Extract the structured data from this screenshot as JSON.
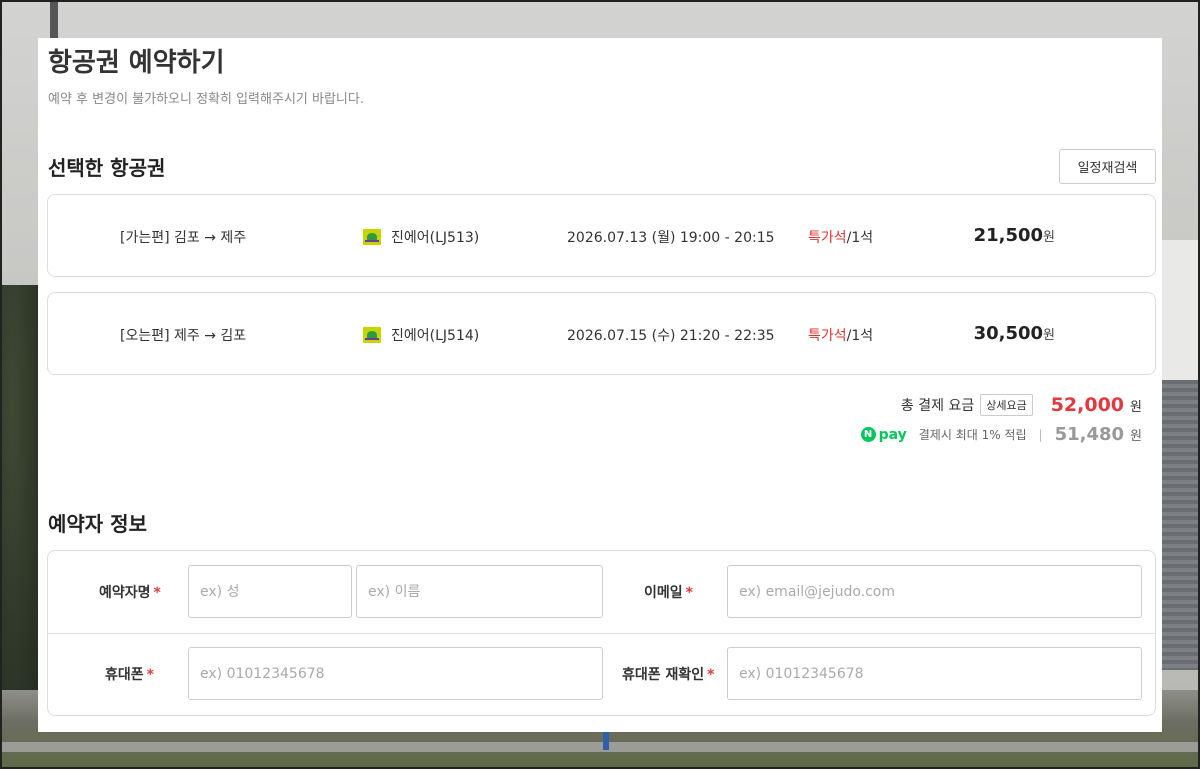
{
  "header": {
    "title": "항공권 예약하기",
    "subtitle": "예약 후 변경이 불가하오니 정확히 입력해주시기 바랍니다."
  },
  "selected_flights": {
    "section_title": "선택한 항공권",
    "research_button": "일정재검색",
    "flights": [
      {
        "route": "[가는편] 김포 → 제주",
        "airline": "진에어(LJ513)",
        "datetime": "2026.07.13 (월) 19:00 - 20:15",
        "seat_type": "특가석",
        "seat_count": "/1석",
        "price": "21,500",
        "currency": "원"
      },
      {
        "route": "[오는편] 제주 → 김포",
        "airline": "진에어(LJ514)",
        "datetime": "2026.07.15 (수) 21:20 - 22:35",
        "seat_type": "특가석",
        "seat_count": "/1석",
        "price": "30,500",
        "currency": "원"
      }
    ],
    "total_label": "총 결제 요금",
    "detail_button": "상세요금",
    "total_amount": "52,000",
    "total_currency": "원",
    "npay": {
      "logo_n": "N",
      "logo_text": "pay",
      "text": "결제시 최대 1% 적립",
      "separator": "|",
      "amount": "51,480",
      "currency": "원"
    }
  },
  "booker": {
    "section_title": "예약자 정보",
    "name_label": "예약자명",
    "last_name_placeholder": "ex) 성",
    "first_name_placeholder": "ex) 이름",
    "email_label": "이메일",
    "email_placeholder": "ex) email@jejudo.com",
    "phone_label": "휴대폰",
    "phone_placeholder": "ex) 01012345678",
    "phone_confirm_label": "휴대폰 재확인",
    "phone_confirm_placeholder": "ex) 01012345678",
    "required_mark": "*"
  },
  "colors": {
    "accent_red": "#e0393e",
    "npay_green": "#03c75a",
    "border": "#dddddd"
  },
  "icons": {
    "airline_logo": "jinair-logo-icon",
    "npay_logo": "npay-logo-icon"
  }
}
